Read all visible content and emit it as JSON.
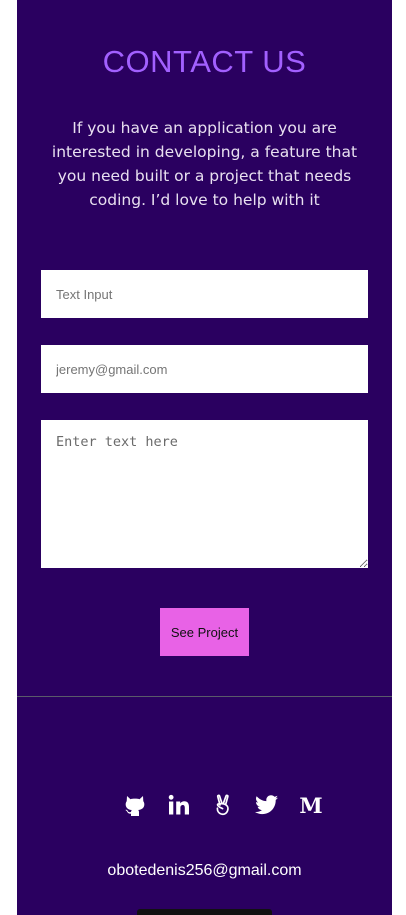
{
  "contact": {
    "title": "CONTACT US",
    "intro": "If you have an application you are interested in developing, a feature that you need built or a project that needs coding. I’d love to help with it",
    "name_placeholder": "Text Input",
    "email_placeholder": "jeremy@gmail.com",
    "message_placeholder": "Enter text here",
    "submit_label": "See Project"
  },
  "footer": {
    "socials": [
      {
        "name": "github",
        "icon": "github-icon"
      },
      {
        "name": "linkedin",
        "icon": "linkedin-icon"
      },
      {
        "name": "angellist",
        "icon": "angellist-icon"
      },
      {
        "name": "twitter",
        "icon": "twitter-icon"
      },
      {
        "name": "medium",
        "icon": "medium-icon",
        "glyph": "M"
      }
    ],
    "email": "obotedenis256@gmail.com"
  },
  "colors": {
    "background": "#2a0060",
    "title": "#a260ff",
    "button": "#e862e6"
  }
}
